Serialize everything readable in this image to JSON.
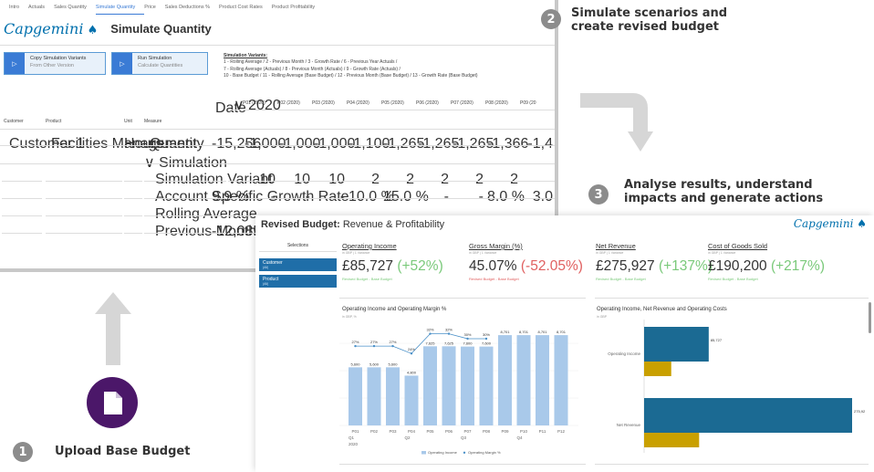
{
  "simulate_screen": {
    "tabs": [
      {
        "label": "Intro",
        "active": false
      },
      {
        "label": "Actuals",
        "active": false
      },
      {
        "label": "Sales Quantity",
        "active": false
      },
      {
        "label": "Simulate Quantity",
        "active": true
      },
      {
        "label": "Price",
        "active": false
      },
      {
        "label": "Sales Deductions %",
        "active": false
      },
      {
        "label": "Product Cost Rates",
        "active": false
      },
      {
        "label": "Product Profitability",
        "active": false
      }
    ],
    "logo_text": "Capgemini",
    "title": "Simulate Quantity",
    "buttons": [
      {
        "label": "Copy Simulation Variants",
        "sub": "From Other Version"
      },
      {
        "label": "Run Simulation",
        "sub": "Calculate Quantities"
      }
    ],
    "variants_heading": "Simulation Variants:",
    "variants_lines": [
      "1 - Rolling Average  /  2 - Previous Month  /  3 - Growth Rate  /  6 - Previous Year Actuals  /",
      "7 - Rolling Average (Actuals)  /  8 - Previous Month (Actuals)  /  9 - Growth Rate (Actuals)  /",
      "10 - Base Budget  /  11 - Rolling Average (Base Budget)  /  12 - Previous Month (Base Budget)  /  13 - Growth Rate (Base Budget)"
    ],
    "date_label": "Date",
    "year_label": "∨ 2020",
    "periods": [
      "P01 (2020)",
      "P02 (2020)",
      "P03 (2020)",
      "P04 (2020)",
      "P05 (2020)",
      "P06 (2020)",
      "P07 (2020)",
      "P08 (2020)",
      "P09 (20"
    ],
    "col_headers": {
      "customer": "Customer",
      "product": "Product",
      "unit": "Unit",
      "measure": "Measure"
    },
    "quantity_row": {
      "customer": "Customer 1",
      "product": "Facilities Management",
      "unit": "Hours",
      "measure": "Quantity",
      "total": "-15,256",
      "values": [
        "-1,000",
        "-1,000",
        "-1,000",
        "-1,100",
        "-1,265",
        "-1,265",
        "-1,265",
        "-1,366",
        "-1,4"
      ]
    },
    "simulation_label": "∨ Simulation",
    "sim_rows": [
      {
        "label": "Simulation Variant",
        "total": "",
        "values": [
          "10",
          "10",
          "10",
          "2",
          "2",
          "2",
          "2",
          "2",
          ""
        ]
      },
      {
        "label": "Account Specific Growth Rate",
        "total": "9.9 %",
        "values": [
          "-",
          "-",
          "-",
          "10.0 %",
          "15.0 %",
          "-",
          "-",
          "8.0 %",
          "3.0"
        ]
      },
      {
        "label": "Rolling Average",
        "total": "",
        "values": [
          "",
          "",
          "",
          "",
          "",
          "",
          "",
          "",
          ""
        ]
      },
      {
        "label": "Previous Month",
        "total": "-12,085.69",
        "values": [
          "",
          "",
          "",
          "",
          "",
          "",
          "",
          "",
          ""
        ]
      }
    ]
  },
  "annotations": {
    "step1": {
      "number": "1",
      "text": "Upload Base Budget"
    },
    "step2": {
      "number": "2",
      "line1": "Simulate scenarios and",
      "line2": "create revised budget"
    },
    "step3": {
      "number": "3",
      "line1": "Analyse results, understand",
      "line2": "impacts and generate actions"
    }
  },
  "revised_screen": {
    "title_bold": "Revised Budget:",
    "title_rest": " Revenue & Profitability",
    "logo_text": "Capgemini",
    "selections_label": "Selections",
    "selection_buttons": [
      {
        "label": "Customer",
        "sub": "(All)"
      },
      {
        "label": "Product",
        "sub": "(All)"
      }
    ],
    "kpis": [
      {
        "title": "Operating Income",
        "sub": "in GBP  |  1 Variance",
        "value": "£85,727",
        "delta": "(+52%)",
        "delta_sign": "pos",
        "footer": "Revised Budget - Base Budget"
      },
      {
        "title": "Gross Margin (%)",
        "sub": "in GBP  |  1 Variance",
        "value": "45.07%",
        "delta": "(-52.05%)",
        "delta_sign": "neg",
        "footer": "Revised Budget - Base Budget"
      },
      {
        "title": "Net Revenue",
        "sub": "in GBP  |  1 Variance",
        "value": "£275,927",
        "delta": "(+137%)",
        "delta_sign": "pos",
        "footer": "Revised Budget - Base Budget"
      },
      {
        "title": "Cost of Goods Sold",
        "sub": "in GBP  |  1 Variance",
        "value": "£190,200",
        "delta": "(+217%)",
        "delta_sign": "pos",
        "footer": "Revised Budget - Base Budget"
      }
    ],
    "chart1_title": "Operating Income and Operating Margin %",
    "chart1_sub": "in GBP, %",
    "chart2_title": "Operating Income, Net Revenue and Operating Costs",
    "chart2_sub": "in GBP",
    "colors": {
      "bar": "#a9c9ea",
      "line": "#4a90c8",
      "dark_bar": "#1b6a93",
      "gold_bar": "#c9a000",
      "brand": "#0070ad"
    }
  },
  "chart_data": [
    {
      "type": "bar",
      "title": "Operating Income and Operating Margin %",
      "categories": [
        "P01",
        "P02",
        "P03",
        "P04",
        "P05",
        "P06",
        "P07",
        "P08",
        "P09",
        "P10",
        "P11",
        "P12"
      ],
      "quarters": [
        "Q1",
        "Q2",
        "Q3",
        "Q4"
      ],
      "year": "2020",
      "series": [
        {
          "name": "Operating Income",
          "values": [
            5600,
            5600,
            5600,
            4800,
            7625,
            7625,
            7600,
            7600,
            8701,
            8701,
            8701,
            8701
          ],
          "labels": [
            "5,600",
            "5,600",
            "5,600",
            "4,800",
            "7,625",
            "7,625",
            "7,600",
            "7,600",
            "8,701",
            "8,701",
            "8,701",
            "8,701"
          ]
        },
        {
          "name": "Operating Margin %",
          "values": [
            27,
            27,
            27,
            24,
            32,
            32,
            30,
            30,
            null,
            null,
            null,
            null
          ],
          "labels": [
            "27%",
            "27%",
            "27%",
            "24%",
            "32%",
            "32%",
            "30%",
            "30%",
            "",
            "",
            "",
            ""
          ]
        }
      ],
      "legend": "bottom"
    },
    {
      "type": "bar",
      "orientation": "horizontal",
      "title": "Operating Income, Net Revenue and Operating Costs",
      "categories": [
        "Operating Income",
        "Net Revenue"
      ],
      "series": [
        {
          "values": [
            85727,
            275927
          ],
          "labels": [
            "85,727",
            "275,927"
          ]
        },
        {
          "values": [
            36000,
            73000
          ],
          "labels": [
            "",
            ""
          ]
        }
      ]
    }
  ]
}
